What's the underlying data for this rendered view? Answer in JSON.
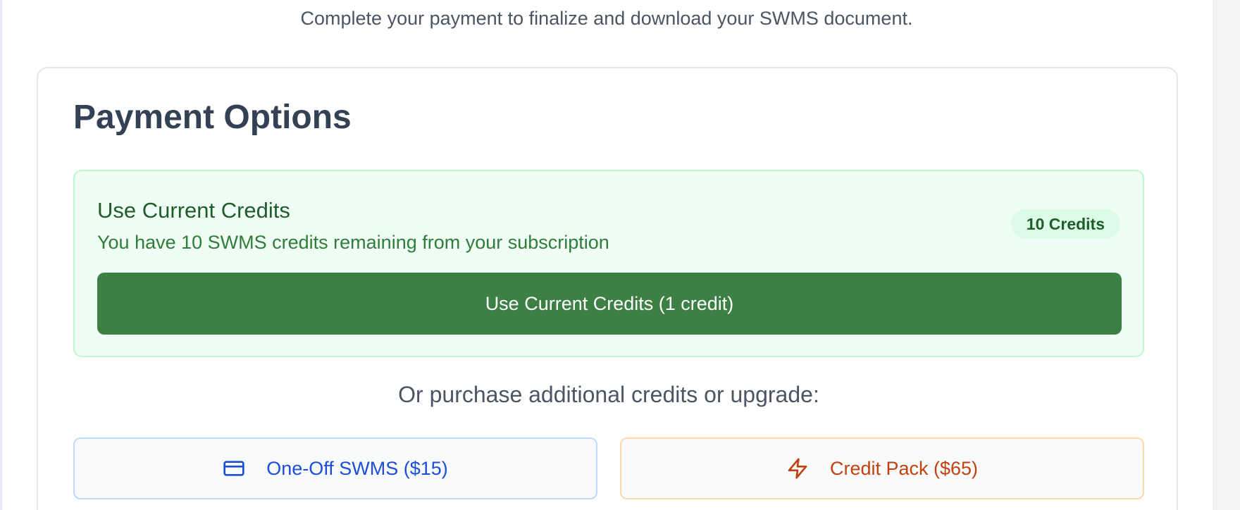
{
  "intro": {
    "text": "Complete your payment to finalize and download your SWMS document."
  },
  "payment": {
    "title": "Payment Options",
    "current_credits": {
      "heading": "Use Current Credits",
      "subtitle": "You have 10 SWMS credits remaining from your subscription",
      "badge": "10 Credits",
      "button_label": "Use Current Credits (1 credit)"
    },
    "or_text": "Or purchase additional credits or upgrade:",
    "options": [
      {
        "label": "One-Off SWMS ($15)",
        "icon": "credit-card-icon"
      },
      {
        "label": "Credit Pack ($65)",
        "icon": "lightning-bolt-icon"
      }
    ]
  },
  "colors": {
    "credits_green": "#3d8045",
    "credits_bg": "#f0fdf4",
    "one_off_blue": "#1d4ed8",
    "credit_pack_orange": "#c2410c",
    "title_slate": "#334155"
  }
}
